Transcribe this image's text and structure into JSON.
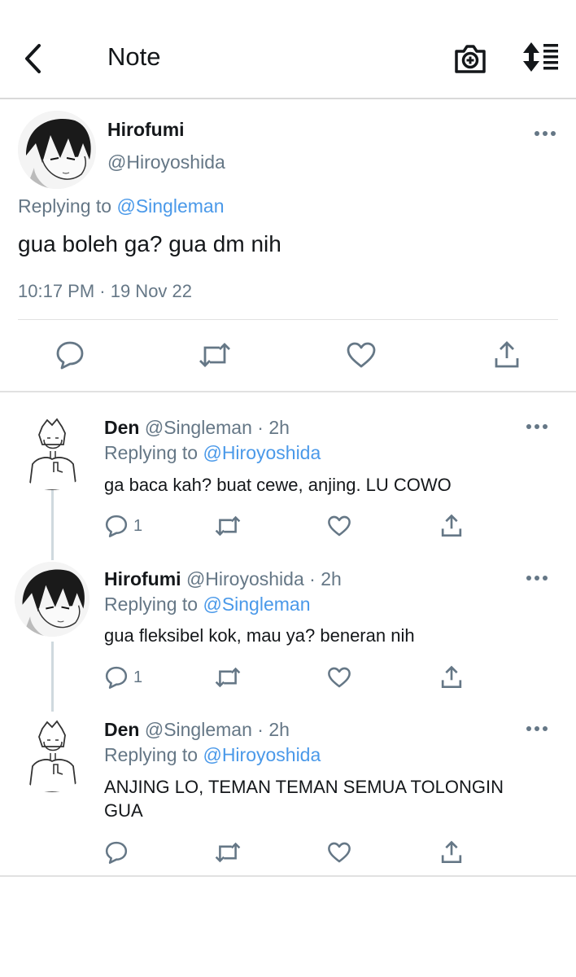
{
  "header": {
    "title": "Note",
    "icons": [
      "back-chevron-icon",
      "camera-plus-icon",
      "sort-icon"
    ]
  },
  "main_tweet": {
    "name": "Hirofumi",
    "handle": "@Hiroyoshida",
    "replying_prefix": "Replying to",
    "replying_to": "@Singleman",
    "text": "gua boleh ga? gua dm nih",
    "timestamp": "10:17 PM · 19 Nov 22"
  },
  "replies": [
    {
      "name": "Den",
      "handle": "@Singleman",
      "time": "· 2h",
      "replying_prefix": "Replying to",
      "replying_to": "@Hiroyoshida",
      "text": "ga baca kah? buat cewe, anjing. LU COWO",
      "reply_count": "1"
    },
    {
      "name": "Hirofumi",
      "handle": "@Hiroyoshida",
      "time": "· 2h",
      "replying_prefix": "Replying to",
      "replying_to": "@Singleman",
      "text": "gua fleksibel kok, mau ya? beneran nih",
      "reply_count": "1"
    },
    {
      "name": "Den",
      "handle": "@Singleman",
      "time": "· 2h",
      "replying_prefix": "Replying to",
      "replying_to": "@Hiroyoshida",
      "text": "ANJING LO, TEMAN TEMAN SEMUA TOLONGIN GUA",
      "reply_count": ""
    }
  ],
  "colors": {
    "accent": "#4a99e9",
    "secondary_text": "#657786",
    "primary_text": "#14171a",
    "divider": "#e1e1e1"
  }
}
